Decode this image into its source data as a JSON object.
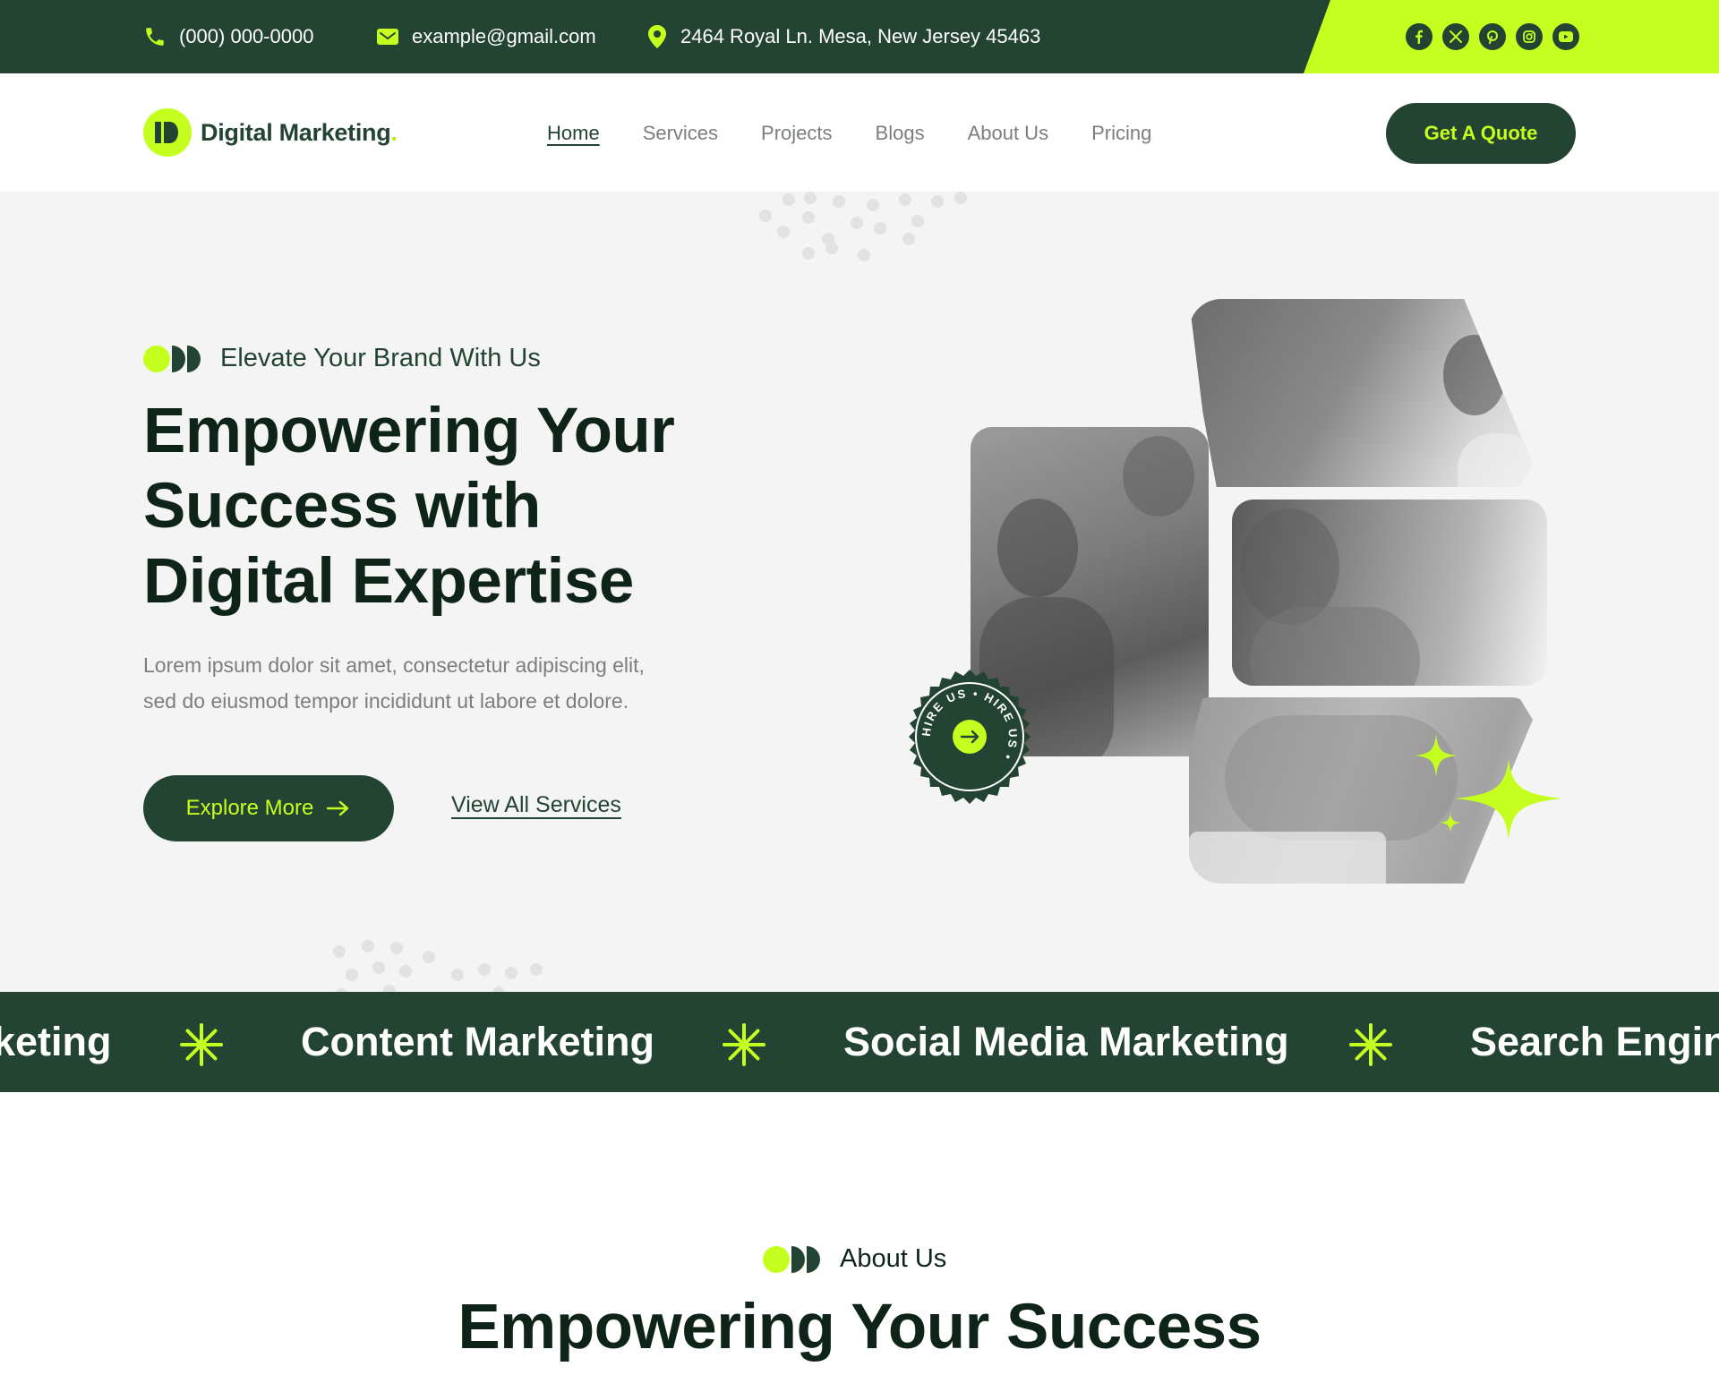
{
  "topbar": {
    "phone": "(000) 000-0000",
    "email": "example@gmail.com",
    "address": "2464 Royal Ln. Mesa, New Jersey 45463",
    "socials": [
      "facebook-icon",
      "x-icon",
      "pinterest-icon",
      "instagram-icon",
      "youtube-icon"
    ]
  },
  "header": {
    "logo_text": "Digital Marketing",
    "logo_dot": ".",
    "nav": [
      "Home",
      "Services",
      "Projects",
      "Blogs",
      "About Us",
      "Pricing"
    ],
    "active_nav": "Home",
    "cta": "Get A Quote"
  },
  "hero": {
    "tagline": "Elevate Your Brand With Us",
    "title_line1": "Empowering Your",
    "title_line2": "Success with",
    "title_line3": "Digital Expertise",
    "description_line1": "Lorem ipsum dolor sit amet, consectetur adipiscing elit,",
    "description_line2": "sed do eiusmod tempor incididunt ut labore et dolore.",
    "primary_button": "Explore More",
    "secondary_link": "View All Services",
    "badge_text": "HIRE US • HIRE US •"
  },
  "marquee": {
    "items": [
      "keting",
      "Content Marketing",
      "Social Media Marketing",
      "Search Engine"
    ]
  },
  "about": {
    "tagline": "About Us",
    "title": "Empowering Your Success"
  },
  "colors": {
    "primary": "#234333",
    "accent": "#c5ff1f",
    "hero_bg": "#f4f4f4",
    "muted_text": "#7a7f7c"
  }
}
